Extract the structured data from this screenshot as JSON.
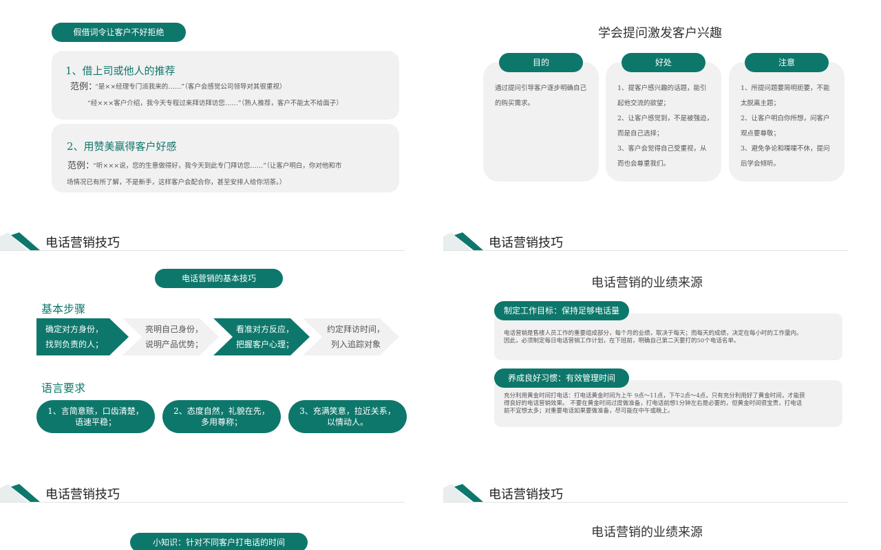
{
  "slide1": {
    "title_pill": "假借词令让客户不好拒绝",
    "item1": {
      "heading": "1、借上司或他人的推荐",
      "example_label": "范例：",
      "line1": "“是××经理专门派我来的……”（客户会感觉公司领导对其很重视）",
      "line2": "“经×××客户介绍，我今天专程过来拜访拜访您……”（熟人推荐，客户不能太不给面子）"
    },
    "item2": {
      "heading": "2、用赞美赢得客户好感",
      "example_label": "范例：",
      "line1": "“听×××说，您的生意做得好，我今天到此专门拜访您……”（让客户明白，你对他和市",
      "line2": "场情况已有所了解，不是新手，这样客户会配合你，甚至安排人给你沏茶。）"
    }
  },
  "slide2": {
    "title": "学会提问激发客户兴趣",
    "columns": [
      {
        "label": "目的",
        "lines": [
          "通过提问引导客户逐步明确自己",
          "的购买需求。"
        ]
      },
      {
        "label": "好处",
        "lines": [
          "1、提客户感兴趣的话题，能引",
          "起他交流的欲望；",
          "2、让客户感觉到，不是被强迫，",
          "而是自己选择；",
          "3、客户会觉得自己受重视，从",
          "而也会尊重我们。"
        ]
      },
      {
        "label": "注意",
        "lines": [
          "1、所提问题要简明扼要，不能",
          "太脱离主题；",
          "2、让客户明白你所想，问客户",
          "观点要尊敬；",
          "3、避免争论和喋喋不休，提问",
          "后学会倾听。"
        ]
      }
    ]
  },
  "slide3": {
    "header": "电话营销技巧",
    "pill": "电话营销的基本技巧",
    "steps_title": "基本步骤",
    "steps": [
      {
        "lines": [
          "确定对方身份，",
          "找到负责的人；"
        ],
        "dark": true
      },
      {
        "lines": [
          "亮明自己身份，",
          "说明产品优势；"
        ],
        "dark": false
      },
      {
        "lines": [
          "看准对方反应，",
          "把握客户心理；"
        ],
        "dark": true
      },
      {
        "lines": [
          "约定拜访时间，",
          "列入追踪对象"
        ],
        "dark": false
      }
    ],
    "req_title": "语言要求",
    "requirements": [
      {
        "lines": [
          "1、言简意赅，口齿清楚，",
          "语速平稳；"
        ]
      },
      {
        "lines": [
          "2、态度自然，礼貌在先，",
          "多用尊称；"
        ]
      },
      {
        "lines": [
          "3、充满笑意，拉近关系，",
          "以情动人。"
        ]
      }
    ]
  },
  "slide4": {
    "header": "电话营销技巧",
    "title": "电话营销的业绩来源",
    "block1": {
      "label": "制定工作目标：保持足够电话量",
      "line1": "电话营销是售楼人员工作的重要组成部分，每个月的业绩，取决于每天；而每天的成绩，决定在每小时的工作量内。",
      "line2": "因此，必须制定每日电话营销工作计划，在下班前，明确自己第二天要打的50个电话名单。"
    },
    "block2": {
      "label": "养成良好习惯：有效管理时间",
      "line1": "充分利用黄金时间打电话：打电话黄金时间为上午 9点～11点，下午2点～4点，只有充分利用好了黄金时间，才能获",
      "line2": "得良好的电话营销效果。 不要在黄金时间过度做准备，打电话前想1分钟左右是必要的，但黄金时间很宝贵，打电话",
      "line3": "前不宜想太多；对重要电话如果要做准备，尽可能在中午或晚上。"
    }
  },
  "slide5": {
    "header": "电话营销技巧",
    "pill": "小知识：针对不同客户打电话的时间"
  },
  "slide6": {
    "header": "电话营销技巧",
    "title": "电话营销的业绩来源"
  },
  "colors": {
    "teal": "#0e776b",
    "card": "#f1f1f1"
  }
}
